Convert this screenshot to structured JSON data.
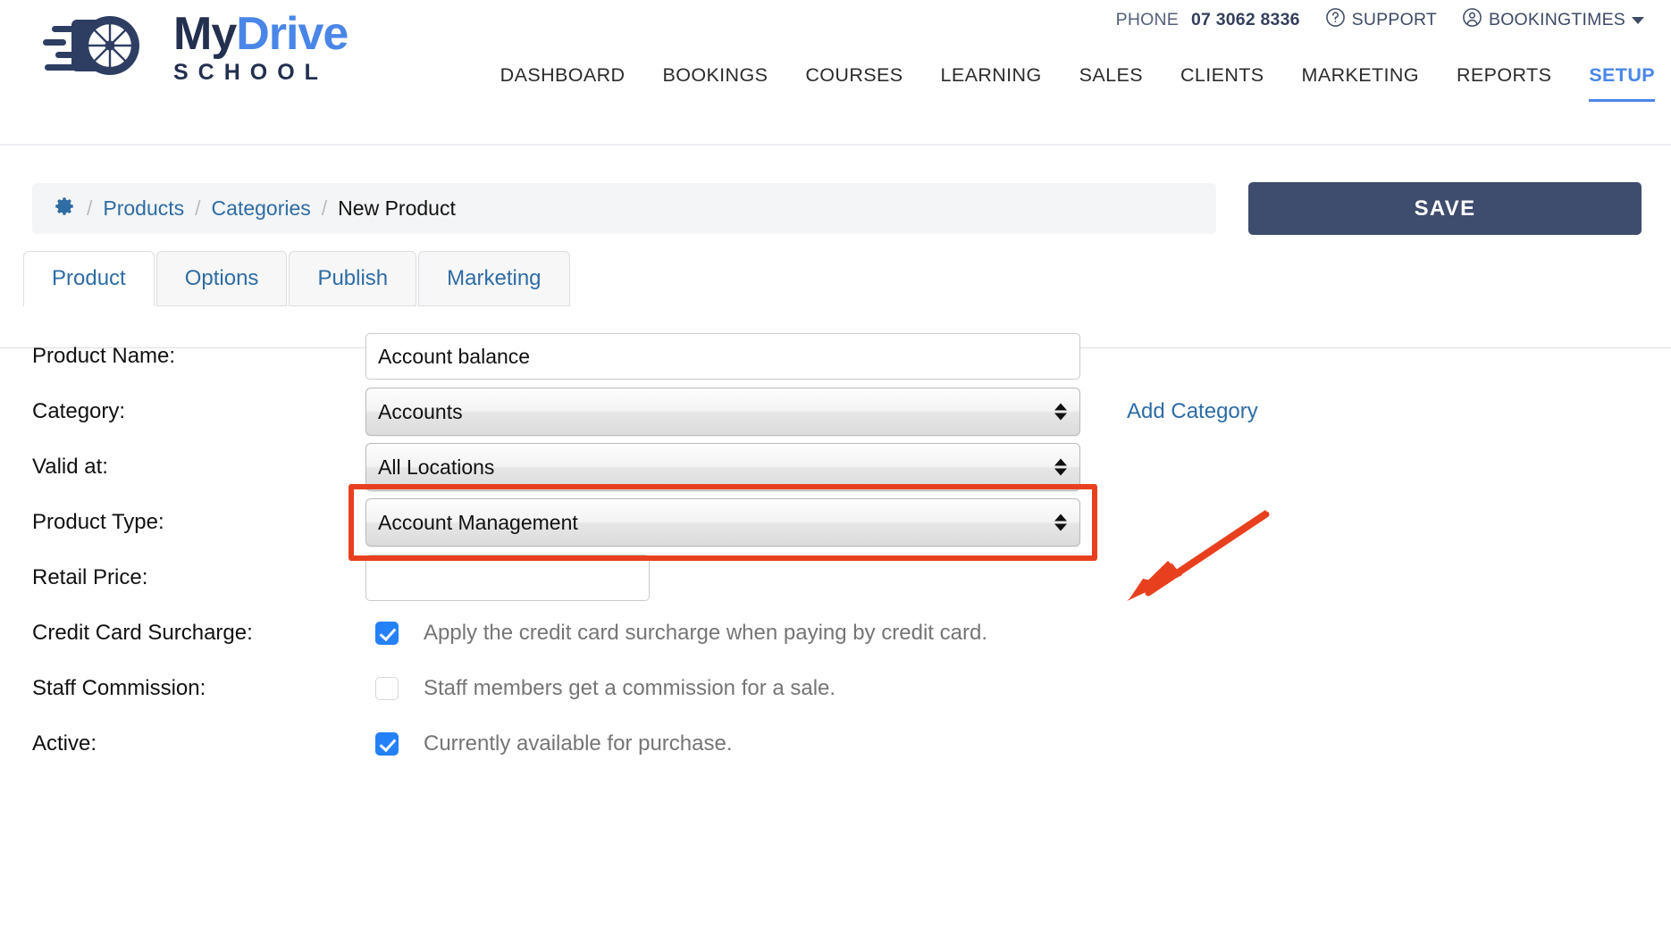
{
  "header": {
    "logo": {
      "icon": "wheel-speed-icon",
      "text_primary": "My",
      "text_accent": "Drive",
      "text_secondary": "SCHOOL",
      "color_primary": "#23304f",
      "color_accent": "#4a86e8"
    },
    "topbar": {
      "phone_label": "PHONE",
      "phone_number": "07 3062 8336",
      "support_label": "SUPPORT",
      "support_icon": "question-circle-icon",
      "account_label": "BOOKINGTIMES",
      "account_icon": "user-circle-icon",
      "caret_icon": "caret-down-icon"
    },
    "nav": {
      "items": [
        {
          "label": "DASHBOARD",
          "active": false
        },
        {
          "label": "BOOKINGS",
          "active": false
        },
        {
          "label": "COURSES",
          "active": false
        },
        {
          "label": "LEARNING",
          "active": false
        },
        {
          "label": "SALES",
          "active": false
        },
        {
          "label": "CLIENTS",
          "active": false
        },
        {
          "label": "MARKETING",
          "active": false
        },
        {
          "label": "REPORTS",
          "active": false
        },
        {
          "label": "SETUP",
          "active": true
        }
      ],
      "active_color": "#4a86e8"
    }
  },
  "breadcrumb": {
    "gear_icon": "gear-icon",
    "sep": "/",
    "items": [
      {
        "label": "Products",
        "link": true
      },
      {
        "label": "Categories",
        "link": true
      },
      {
        "label": "New Product",
        "link": false
      }
    ]
  },
  "actions": {
    "save_label": "SAVE",
    "save_color": "#3e4c6d"
  },
  "tabs": [
    {
      "label": "Product",
      "active": true
    },
    {
      "label": "Options",
      "active": false
    },
    {
      "label": "Publish",
      "active": false
    },
    {
      "label": "Marketing",
      "active": false
    }
  ],
  "form": {
    "product_name": {
      "label": "Product Name:",
      "value": "Account balance",
      "placeholder": ""
    },
    "category": {
      "label": "Category:",
      "value": "Accounts",
      "add_link": "Add Category"
    },
    "valid_at": {
      "label": "Valid at:",
      "value": "All Locations"
    },
    "product_type": {
      "label": "Product Type:",
      "value": "Account Management",
      "highlighted": true,
      "highlight_color": "#e8401f"
    },
    "retail_price": {
      "label": "Retail Price:",
      "value": "",
      "placeholder": ""
    },
    "credit_card_surcharge": {
      "label": "Credit Card Surcharge:",
      "checkbox_text": "Apply the credit card surcharge when paying by credit card.",
      "checked": true
    },
    "staff_commission": {
      "label": "Staff Commission:",
      "checkbox_text": "Staff members get a commission for a sale.",
      "checked": false
    },
    "active": {
      "label": "Active:",
      "checkbox_text": "Currently available for purchase.",
      "checked": true
    }
  },
  "annotation": {
    "arrow_icon": "arrow-pointing-left-down-icon",
    "color": "#e8401f"
  }
}
